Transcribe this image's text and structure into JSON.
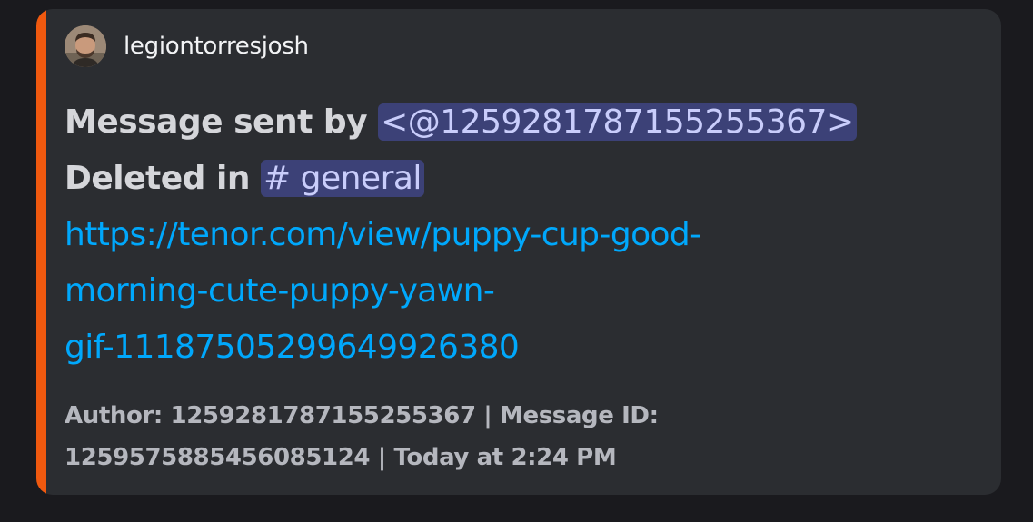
{
  "embed": {
    "accent_color": "#f0590f",
    "author": {
      "name": "legiontorresjosh",
      "avatar": "user-avatar"
    },
    "description": {
      "line1_prefix": "Message sent by",
      "mention": "<@1259281787155255367>",
      "line2_prefix": "Deleted in",
      "channel_mention": "# general",
      "link_lines": [
        "https://tenor.com/view/puppy-cup-good-",
        "morning-cute-puppy-yawn-",
        "gif-11187505299649926380"
      ]
    },
    "footer": {
      "line1": "Author: 1259281787155255367 | Message ID:",
      "line2": "1259575885456085124 | Today at 2:24 PM"
    }
  }
}
